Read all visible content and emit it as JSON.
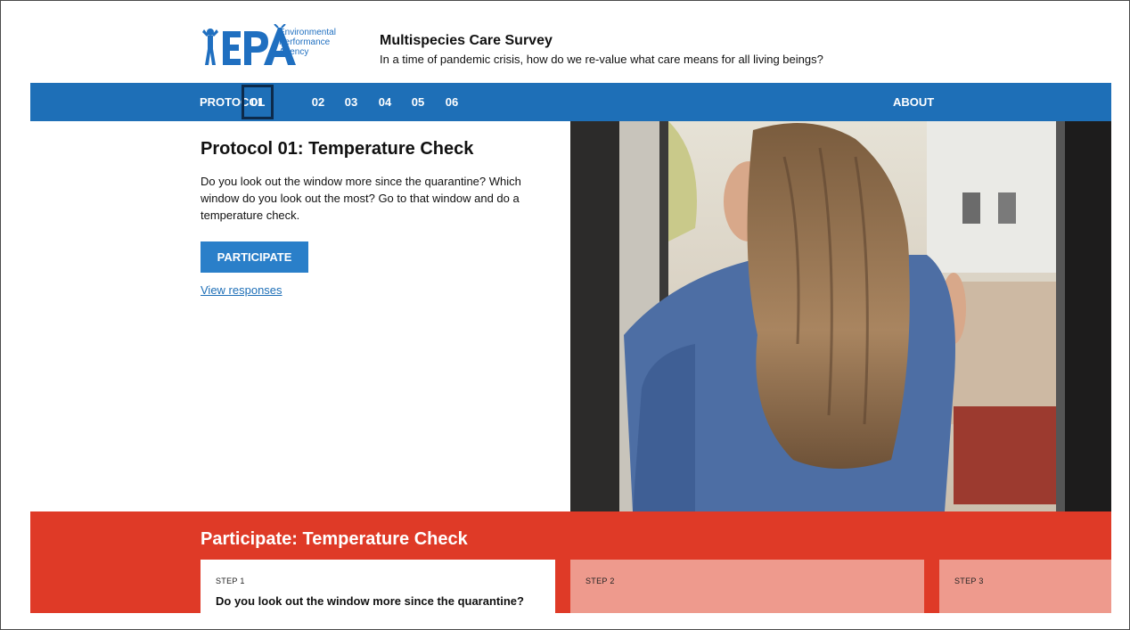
{
  "header": {
    "logo_text": "EPA",
    "agency_lines": [
      "Environmental",
      "Performance",
      "Agency"
    ],
    "title": "Multispecies Care Survey",
    "subtitle": "In a time of pandemic crisis, how do we re-value what care means for all living beings?"
  },
  "nav": {
    "protocol_label": "PROTOCOL",
    "numbers": [
      "01",
      "02",
      "03",
      "04",
      "05",
      "06"
    ],
    "active": "01",
    "about_label": "ABOUT"
  },
  "protocol": {
    "title": "Protocol 01: Temperature Check",
    "description": "Do you look out the window more since the quarantine? Which window do you look out the most? Go to that window and do a temperature check.",
    "participate_label": "PARTICIPATE",
    "view_responses_label": "View responses"
  },
  "participate_section": {
    "title": "Participate: Temperature Check",
    "steps": [
      {
        "label": "STEP 1",
        "question": "Do you look out the window more since the quarantine?"
      },
      {
        "label": "STEP 2",
        "question": ""
      },
      {
        "label": "STEP 3",
        "question": ""
      }
    ]
  },
  "colors": {
    "nav_blue": "#1e6fb7",
    "button_blue": "#2a7fc9",
    "band_red": "#df3a27",
    "step_inactive": "#ee9a8d"
  }
}
